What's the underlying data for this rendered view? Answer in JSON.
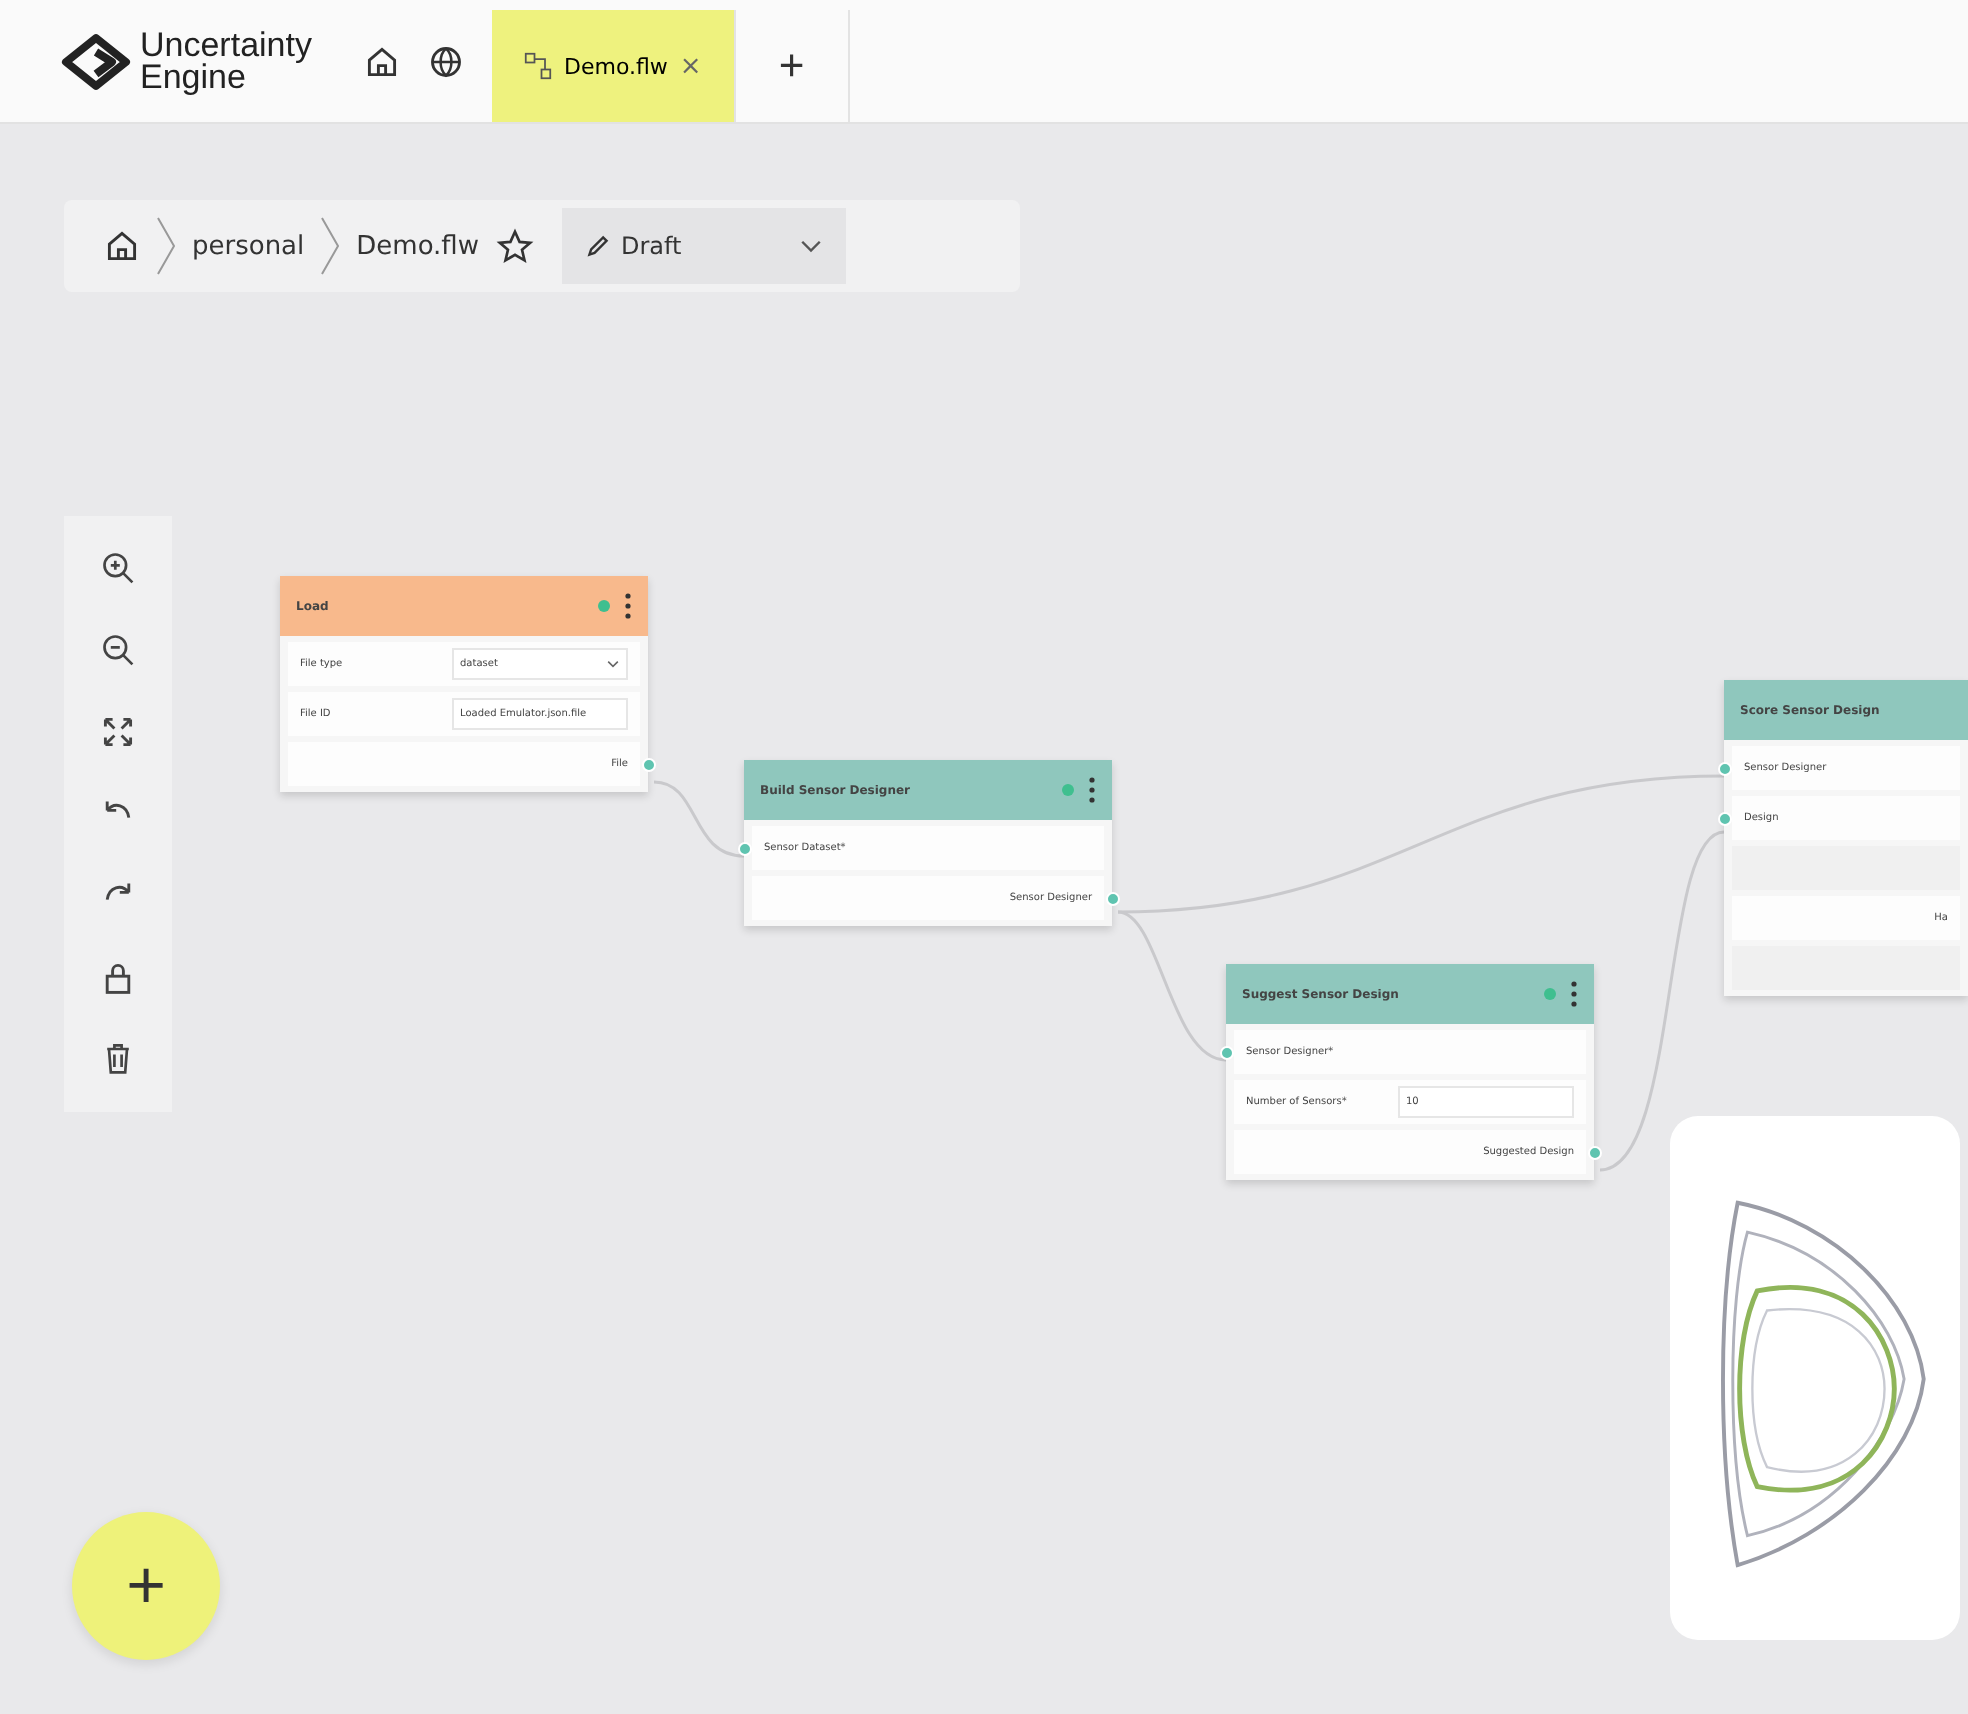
{
  "app": {
    "logo_line_1": "Uncertainty",
    "logo_line_2": "Engine"
  },
  "tabs": [
    {
      "label": "Demo.flw",
      "close": "×",
      "selected": true
    }
  ],
  "new_tab": "+",
  "breadcrumb": {
    "items": [
      "personal",
      "Demo.flw"
    ],
    "status": "Draft"
  },
  "nodes": [
    {
      "title": "Load",
      "color": "#f8b98c",
      "fields": [
        {
          "label": "File type",
          "value": "dataset",
          "kind": "select"
        },
        {
          "label": "File ID",
          "value": "Loaded Emulator.json.file",
          "kind": "text"
        }
      ],
      "outputs": [
        "File"
      ]
    },
    {
      "title": "Build Sensor Designer",
      "color": "#8fc7bd",
      "inputs": [
        "Sensor Dataset*"
      ],
      "outputs": [
        "Sensor Designer"
      ]
    },
    {
      "title": "Suggest Sensor Design",
      "color": "#8fc7bd",
      "fields": [
        {
          "label": "Number of Sensors*",
          "value": "10",
          "kind": "text"
        }
      ],
      "inputs": [
        "Sensor Designer*"
      ],
      "outputs": [
        "Suggested Design"
      ]
    },
    {
      "title": "Score Sensor Design",
      "color": "#8fc7bd",
      "inputs": [
        "Sensor Designer",
        "Design"
      ],
      "outputs": [
        "Ha"
      ]
    }
  ],
  "add_button": "+"
}
